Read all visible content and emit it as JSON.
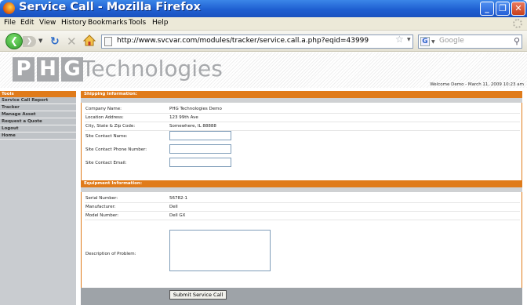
{
  "window": {
    "title": "Service Call - Mozilla Firefox",
    "minimize": "_",
    "maximize": "❐",
    "close": "✕"
  },
  "menu": [
    "File",
    "Edit",
    "View",
    "History",
    "Bookmarks",
    "Tools",
    "Help"
  ],
  "nav": {
    "url": "http://www.svcvar.com/modules/tracker/service.call.a.php?eqid=43999",
    "search_placeholder": "Google",
    "search_engine_glyph": "G"
  },
  "site": {
    "logo_letters": [
      "P",
      "H",
      "G"
    ],
    "logo_word": "Technologies",
    "welcome": "Welcome Demo - March 11, 2009 10:23 am"
  },
  "sidebar": {
    "heading": "Tools",
    "items": [
      "Service Call Report",
      "Tracker",
      "Manage Asset",
      "Request a Quote",
      "Logout",
      "Home"
    ]
  },
  "shipping": {
    "heading": "Shipping Information:",
    "rows": [
      {
        "label": "Company Name:",
        "value": "PHG Technologies Demo"
      },
      {
        "label": "Location Address:",
        "value": "123 99th Ave"
      },
      {
        "label": "City, State & Zip Code:",
        "value": "Somewhere,  IL  88888"
      }
    ],
    "inputs": [
      {
        "label": "Site Contact Name:",
        "value": ""
      },
      {
        "label": "Site Contact Phone Number:",
        "value": ""
      },
      {
        "label": "Site Contact Email:",
        "value": ""
      }
    ]
  },
  "equipment": {
    "heading": "Equipment Information:",
    "rows": [
      {
        "label": "Serial Number:",
        "value": "56782-1"
      },
      {
        "label": "Manufacturer:",
        "value": "Dell"
      },
      {
        "label": "Model Number:",
        "value": "Dell GX"
      }
    ],
    "description_label": "Description of Problem:",
    "description_value": ""
  },
  "submit_label": "Submit Service Call"
}
